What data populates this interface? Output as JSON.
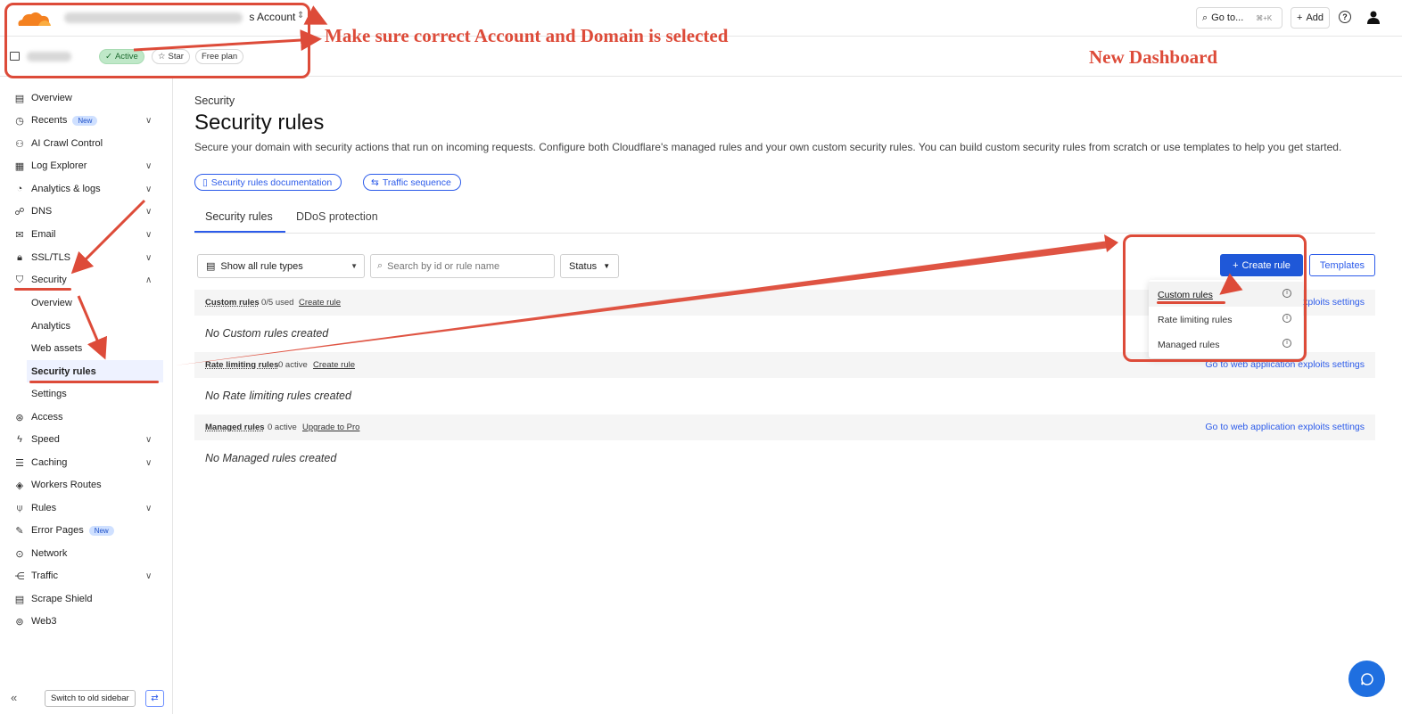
{
  "header": {
    "account_label": "s Account",
    "goto_label": "Go to...",
    "goto_shortcut": "⌘+K",
    "add_label": "Add",
    "help_glyph": "?"
  },
  "domain_bar": {
    "status_badge": "Active",
    "star_label": "Star",
    "plan_badge": "Free plan"
  },
  "sidebar": {
    "items": [
      {
        "label": "Overview",
        "icon": "document-icon"
      },
      {
        "label": "Recents",
        "icon": "clock-icon",
        "badge": "New"
      },
      {
        "label": "AI Crawl Control",
        "icon": "robot-icon"
      },
      {
        "label": "Log Explorer",
        "icon": "log-icon"
      },
      {
        "label": "Analytics & logs",
        "icon": "chart-pie-icon"
      },
      {
        "label": "DNS",
        "icon": "network-tree-icon"
      },
      {
        "label": "Email",
        "icon": "email-icon"
      },
      {
        "label": "SSL/TLS",
        "icon": "lock-icon"
      },
      {
        "label": "Security",
        "icon": "shield-icon"
      },
      {
        "label": "Access",
        "icon": "access-icon"
      },
      {
        "label": "Speed",
        "icon": "bolt-icon"
      },
      {
        "label": "Caching",
        "icon": "database-icon"
      },
      {
        "label": "Workers Routes",
        "icon": "workers-icon"
      },
      {
        "label": "Rules",
        "icon": "rules-icon"
      },
      {
        "label": "Error Pages",
        "icon": "wrench-icon",
        "badge": "New"
      },
      {
        "label": "Network",
        "icon": "location-pin-icon"
      },
      {
        "label": "Traffic",
        "icon": "traffic-icon"
      },
      {
        "label": "Scrape Shield",
        "icon": "page-icon"
      },
      {
        "label": "Web3",
        "icon": "web3-icon"
      }
    ],
    "security_sub": [
      "Overview",
      "Analytics",
      "Web assets",
      "Security rules",
      "Settings"
    ],
    "old_sidebar_label": "Switch to old sidebar"
  },
  "main": {
    "breadcrumb": "Security",
    "title": "Security rules",
    "description": "Secure your domain with security actions that run on incoming requests. Configure both Cloudflare's managed rules and your own custom security rules. You can build custom security rules from scratch or use templates to help you get started.",
    "doc_link": "Security rules documentation",
    "sequence_link": "Traffic sequence",
    "tabs": [
      "Security rules",
      "DDoS protection"
    ],
    "filter_type": "Show all rule types",
    "search_placeholder": "Search by id or rule name",
    "status_filter": "Status",
    "create_button": "Create rule",
    "templates_button": "Templates",
    "sections": [
      {
        "title": "Custom rules",
        "count": "0/5 used",
        "action": "Create rule",
        "right_link": "Go to web application exploits settings",
        "empty": "No Custom rules created"
      },
      {
        "title": "Rate limiting rules",
        "count": "0 active",
        "action": "Create rule",
        "right_link": "Go to web application exploits settings",
        "empty": "No Rate limiting rules created"
      },
      {
        "title": "Managed rules",
        "count": "0 active",
        "action": "Upgrade to Pro",
        "right_link": "Go to web application exploits settings",
        "empty": "No Managed rules created"
      }
    ],
    "dropdown": [
      "Custom rules",
      "Rate limiting rules",
      "Managed rules"
    ]
  },
  "annotations": {
    "account_note": "Make sure correct Account and Domain is selected",
    "dashboard_note": "New Dashboard"
  },
  "colors": {
    "accent": "#1f58d8",
    "annotation": "#dd4b39",
    "brand_orange": "#f48120"
  }
}
